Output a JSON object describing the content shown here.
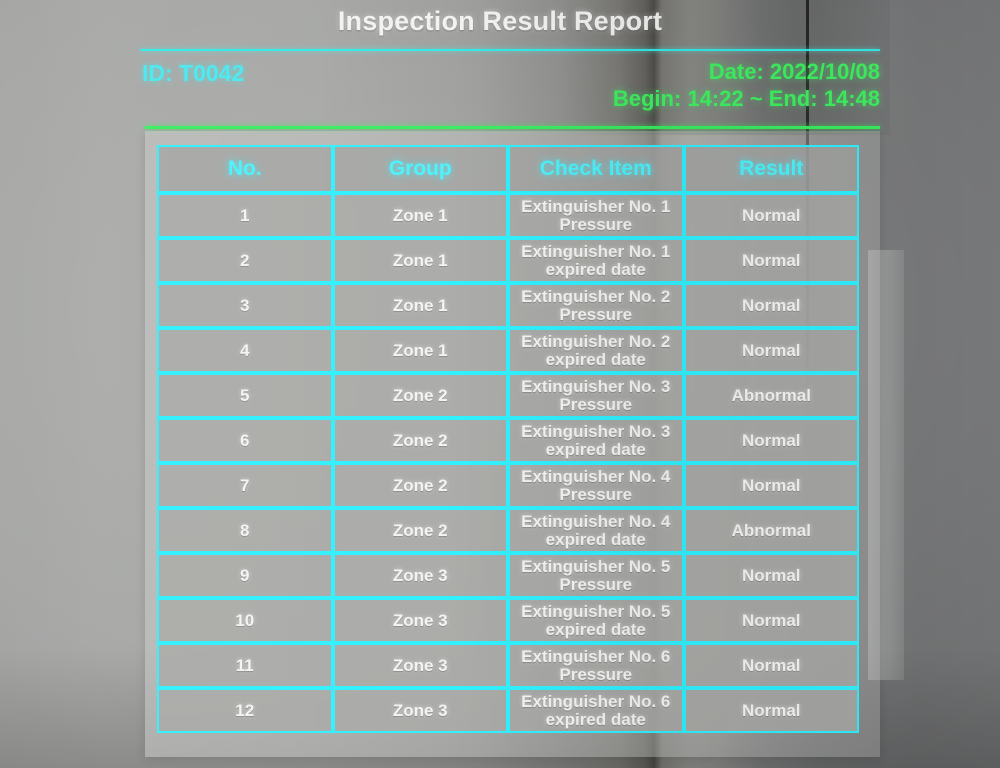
{
  "header": {
    "title": "Inspection Result Report",
    "id_label": "ID: T0042",
    "date_line": "Date: 2022/10/08",
    "time_line": "Begin: 14:22 ~ End: 14:48"
  },
  "colors": {
    "cyan_accent": "#2ff0ff",
    "green_accent": "#3bf061",
    "result_normal_bg": "#00f080",
    "result_abnormal_bg": "#f80a0a",
    "title_text": "#f2f3f1",
    "panel_bg": "#a8a9a6"
  },
  "table": {
    "columns": [
      "No.",
      "Group",
      "Check Item",
      "Result"
    ],
    "rows": [
      {
        "no": "1",
        "group": "Zone 1",
        "item_line1": "Extinguisher No. 1",
        "item_line2": "Pressure",
        "result": "Normal",
        "status": "normal"
      },
      {
        "no": "2",
        "group": "Zone 1",
        "item_line1": "Extinguisher No. 1",
        "item_line2": "expired date",
        "result": "Normal",
        "status": "normal"
      },
      {
        "no": "3",
        "group": "Zone 1",
        "item_line1": "Extinguisher No. 2",
        "item_line2": "Pressure",
        "result": "Normal",
        "status": "normal"
      },
      {
        "no": "4",
        "group": "Zone 1",
        "item_line1": "Extinguisher No. 2",
        "item_line2": "expired date",
        "result": "Normal",
        "status": "normal"
      },
      {
        "no": "5",
        "group": "Zone 2",
        "item_line1": "Extinguisher No. 3",
        "item_line2": "Pressure",
        "result": "Abnormal",
        "status": "abnormal"
      },
      {
        "no": "6",
        "group": "Zone 2",
        "item_line1": "Extinguisher No. 3",
        "item_line2": "expired date",
        "result": "Normal",
        "status": "normal"
      },
      {
        "no": "7",
        "group": "Zone 2",
        "item_line1": "Extinguisher No. 4",
        "item_line2": "Pressure",
        "result": "Normal",
        "status": "normal"
      },
      {
        "no": "8",
        "group": "Zone 2",
        "item_line1": "Extinguisher No. 4",
        "item_line2": "expired date",
        "result": "Abnormal",
        "status": "abnormal"
      },
      {
        "no": "9",
        "group": "Zone 3",
        "item_line1": "Extinguisher No. 5",
        "item_line2": "Pressure",
        "result": "Normal",
        "status": "normal"
      },
      {
        "no": "10",
        "group": "Zone 3",
        "item_line1": "Extinguisher No. 5",
        "item_line2": "expired date",
        "result": "Normal",
        "status": "normal"
      },
      {
        "no": "11",
        "group": "Zone 3",
        "item_line1": "Extinguisher No. 6",
        "item_line2": "Pressure",
        "result": "Normal",
        "status": "normal"
      },
      {
        "no": "12",
        "group": "Zone 3",
        "item_line1": "Extinguisher No. 6",
        "item_line2": "expired date",
        "result": "Normal",
        "status": "normal"
      }
    ]
  }
}
